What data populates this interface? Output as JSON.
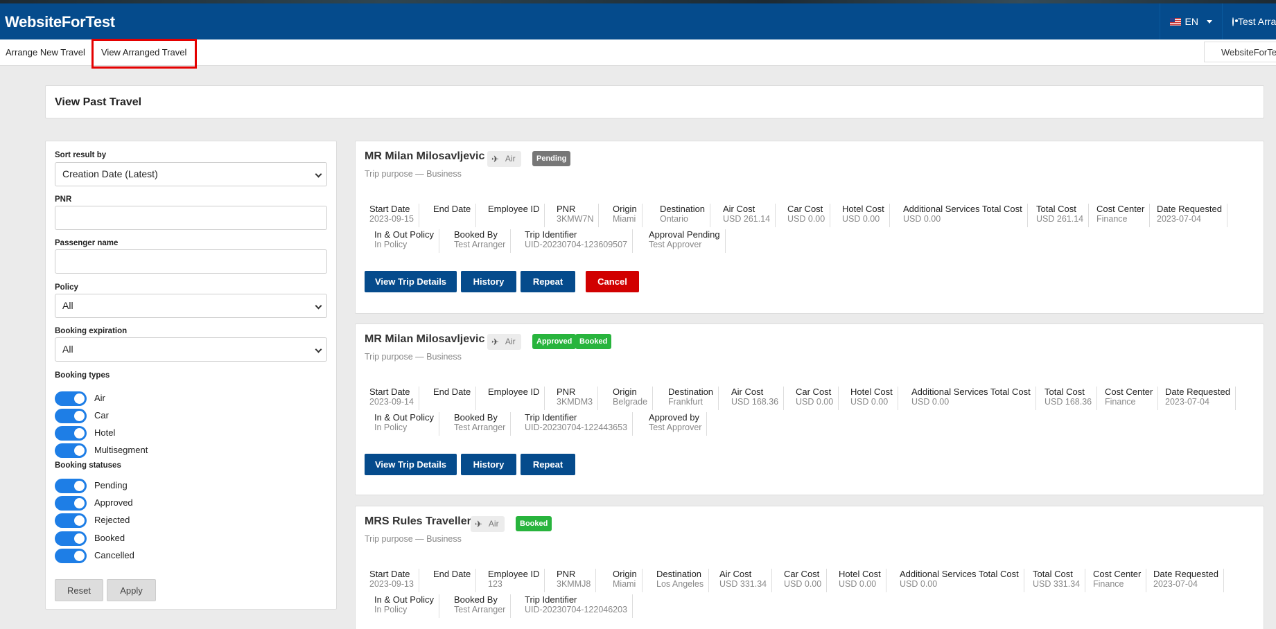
{
  "app": {
    "brand": "WebsiteForTest",
    "language": "EN",
    "user": "Test Arranger"
  },
  "subnav": {
    "arrange": "Arrange New Travel",
    "view": "View Arranged Travel",
    "company": "WebsiteForTest"
  },
  "page": {
    "title": "View Past Travel"
  },
  "filters": {
    "sort_label": "Sort result by",
    "sort_value": "Creation Date (Latest)",
    "pnr_label": "PNR",
    "pnr_value": "",
    "passenger_label": "Passenger name",
    "passenger_value": "",
    "policy_label": "Policy",
    "policy_value": "All",
    "expiration_label": "Booking expiration",
    "expiration_value": "All",
    "types_label": "Booking types",
    "types": [
      {
        "label": "Air",
        "on": true
      },
      {
        "label": "Car",
        "on": true
      },
      {
        "label": "Hotel",
        "on": true
      },
      {
        "label": "Multisegment",
        "on": true
      }
    ],
    "statuses_label": "Booking statuses",
    "statuses": [
      {
        "label": "Pending",
        "on": true
      },
      {
        "label": "Approved",
        "on": true
      },
      {
        "label": "Rejected",
        "on": true
      },
      {
        "label": "Booked",
        "on": true
      },
      {
        "label": "Cancelled",
        "on": true
      }
    ],
    "reset": "Reset",
    "apply": "Apply"
  },
  "trips": [
    {
      "name": "MR Milan Milosavljevic",
      "mode": "Air",
      "badges": [
        "Pending"
      ],
      "purpose": "Trip purpose — Business",
      "row1": [
        {
          "label": "Start Date",
          "value": "2023-09-15"
        },
        {
          "label": "End Date",
          "value": ""
        },
        {
          "label": "Employee ID",
          "value": ""
        },
        {
          "label": "PNR",
          "value": "3KMW7N"
        },
        {
          "label": "Origin",
          "value": "Miami"
        },
        {
          "label": "Destination",
          "value": "Ontario"
        },
        {
          "label": "Air Cost",
          "value": "USD 261.14"
        },
        {
          "label": "Car Cost",
          "value": "USD 0.00"
        },
        {
          "label": "Hotel Cost",
          "value": "USD 0.00"
        },
        {
          "label": "Additional Services Total Cost",
          "value": "USD 0.00"
        },
        {
          "label": "Total Cost",
          "value": "USD 261.14"
        },
        {
          "label": "Cost Center",
          "value": "Finance"
        },
        {
          "label": "Date Requested",
          "value": "2023-07-04"
        }
      ],
      "row2": [
        {
          "label": "In & Out Policy",
          "value": "In Policy"
        },
        {
          "label": "Booked By",
          "value": "Test Arranger"
        },
        {
          "label": "Trip Identifier",
          "value": "UID-20230704-123609507"
        },
        {
          "label": "Approval Pending",
          "value": "Test Approver"
        }
      ],
      "buttons": [
        "View Trip Details",
        "History",
        "Repeat",
        "Cancel"
      ]
    },
    {
      "name": "MR Milan Milosavljevic",
      "mode": "Air",
      "badges": [
        "Approved",
        "Booked"
      ],
      "purpose": "Trip purpose — Business",
      "row1": [
        {
          "label": "Start Date",
          "value": "2023-09-14"
        },
        {
          "label": "End Date",
          "value": ""
        },
        {
          "label": "Employee ID",
          "value": ""
        },
        {
          "label": "PNR",
          "value": "3KMDM3"
        },
        {
          "label": "Origin",
          "value": "Belgrade"
        },
        {
          "label": "Destination",
          "value": "Frankfurt"
        },
        {
          "label": "Air Cost",
          "value": "USD 168.36"
        },
        {
          "label": "Car Cost",
          "value": "USD 0.00"
        },
        {
          "label": "Hotel Cost",
          "value": "USD 0.00"
        },
        {
          "label": "Additional Services Total Cost",
          "value": "USD 0.00"
        },
        {
          "label": "Total Cost",
          "value": "USD 168.36"
        },
        {
          "label": "Cost Center",
          "value": "Finance"
        },
        {
          "label": "Date Requested",
          "value": "2023-07-04"
        }
      ],
      "row2": [
        {
          "label": "In & Out Policy",
          "value": "In Policy"
        },
        {
          "label": "Booked By",
          "value": "Test Arranger"
        },
        {
          "label": "Trip Identifier",
          "value": "UID-20230704-122443653"
        },
        {
          "label": "Approved by",
          "value": "Test Approver"
        }
      ],
      "buttons": [
        "View Trip Details",
        "History",
        "Repeat"
      ]
    },
    {
      "name": "MRS Rules Traveller",
      "mode": "Air",
      "badges": [
        "Booked"
      ],
      "purpose": "Trip purpose — Business",
      "row1": [
        {
          "label": "Start Date",
          "value": "2023-09-13"
        },
        {
          "label": "End Date",
          "value": ""
        },
        {
          "label": "Employee ID",
          "value": "123"
        },
        {
          "label": "PNR",
          "value": "3KMMJ8"
        },
        {
          "label": "Origin",
          "value": "Miami"
        },
        {
          "label": "Destination",
          "value": "Los Angeles"
        },
        {
          "label": "Air Cost",
          "value": "USD 331.34"
        },
        {
          "label": "Car Cost",
          "value": "USD 0.00"
        },
        {
          "label": "Hotel Cost",
          "value": "USD 0.00"
        },
        {
          "label": "Additional Services Total Cost",
          "value": "USD 0.00"
        },
        {
          "label": "Total Cost",
          "value": "USD 331.34"
        },
        {
          "label": "Cost Center",
          "value": "Finance"
        },
        {
          "label": "Date Requested",
          "value": "2023-07-04"
        }
      ],
      "row2": [
        {
          "label": "In & Out Policy",
          "value": "In Policy"
        },
        {
          "label": "Booked By",
          "value": "Test Arranger"
        },
        {
          "label": "Trip Identifier",
          "value": "UID-20230704-122046203"
        }
      ],
      "buttons": []
    }
  ]
}
